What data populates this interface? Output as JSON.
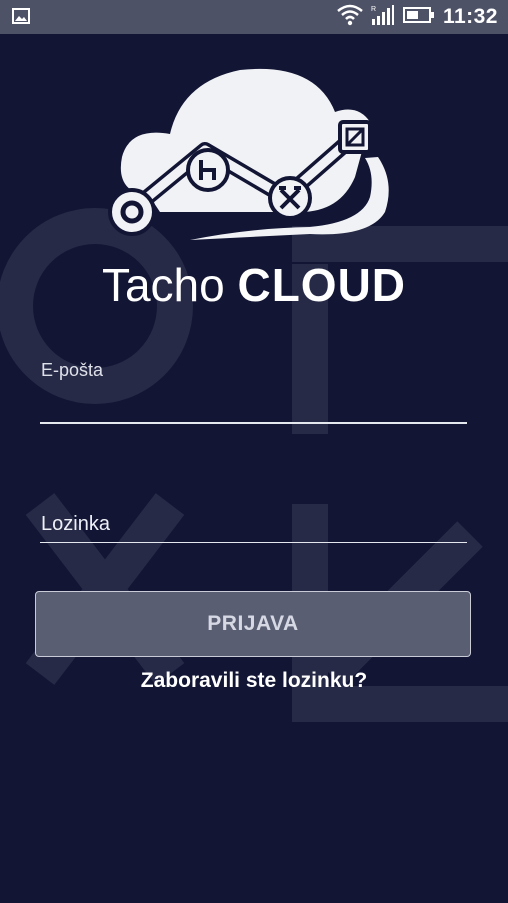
{
  "status_bar": {
    "time": "11:32",
    "icons": [
      "image-icon",
      "wifi-icon",
      "signal-icon",
      "battery-icon"
    ]
  },
  "brand": {
    "name_light": "Tacho",
    "name_bold": "CLOUD"
  },
  "form": {
    "email_label": "E-pošta",
    "email_value": "",
    "password_label": "Lozinka",
    "password_value": "",
    "login_label": "PRIJAVA",
    "forgot_label": "Zaboravili ste lozinku?"
  },
  "colors": {
    "background": "#121634",
    "status_bar": "#4e5267",
    "button": "#5a5e73",
    "text": "#ffffff"
  }
}
